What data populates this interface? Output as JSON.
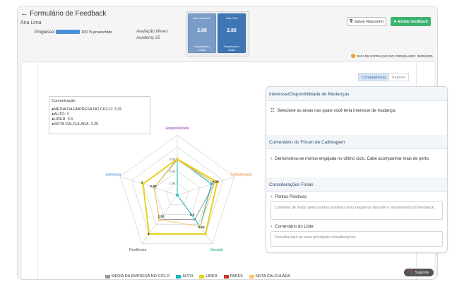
{
  "header": {
    "back_icon": "arrow-left-icon",
    "title": "Formulário de Feedback",
    "user_name": "Ana Lima",
    "progress_label": "Progresso:",
    "progress_value": 100,
    "progress_text": "100 % preenchido",
    "evaluation_line1": "Avaliação Mereo",
    "evaluation_line2": "Academy 25",
    "card1": {
      "title": "Nota Calculada",
      "value": "2.88",
      "sub1": "Proposta para a",
      "sub2": "função"
    },
    "card2": {
      "title": "Nota Final",
      "value": "2.88",
      "sub1": "Proposta para a",
      "sub2": "função"
    },
    "save_label": "Salvar Rascunho",
    "send_label": "Enviar feedback",
    "expiration": "DATA DE EXPIRAÇÃO DO FORMULÁRIO: 30/05/2025"
  },
  "tabs": [
    {
      "label": "Competências",
      "active": true
    },
    {
      "label": "Fatores",
      "active": false
    }
  ],
  "legend_box": {
    "title": "Comunicação",
    "items": [
      "●MÉDIA DA EMPRESA NO CICLO: 3.25",
      "●AUTO: 3",
      "●LIDER: 3.5",
      "●NOTA CALCULADA: 3.25"
    ]
  },
  "chart_data": {
    "type": "radar",
    "axes": [
      "Adaptabilidade",
      "Comunicação",
      "Decisão",
      "Resiliência",
      "Liderança"
    ],
    "rlim": [
      0,
      5
    ],
    "grid_labels": [
      "1.00",
      "2.00",
      "3.00"
    ],
    "series": [
      {
        "name": "MÉDIA DA EMPRESA NO CICLO",
        "color": "#999999",
        "values": [
          3,
          3.25,
          2.5,
          2.52,
          2.03
        ]
      },
      {
        "name": "AUTO",
        "color": "#17b3b3",
        "values": [
          3,
          3,
          3.24,
          0,
          0
        ]
      },
      {
        "name": "LIDER",
        "color": "#e6d21c",
        "values": [
          3,
          3.5,
          4,
          4,
          3
        ]
      },
      {
        "name": "PARES",
        "color": "#c0392b",
        "values": []
      },
      {
        "name": "NOTA CALCULADA",
        "color": "#f7c96b",
        "values": [
          2.9,
          3.25,
          3.24,
          2.52,
          2.03
        ]
      }
    ],
    "data_labels": [
      {
        "text": "3.25",
        "axis": 1,
        "r": 3.35
      },
      {
        "text": "3",
        "axis": 4,
        "r": 3.1
      },
      {
        "text": "2.03",
        "axis": 4,
        "r": 2.1
      },
      {
        "text": "2.5",
        "axis": 2,
        "r": 2.1
      },
      {
        "text": "3.24",
        "axis": 2,
        "r": 3.4
      },
      {
        "text": "2.52",
        "axis": 3,
        "r": 2.3
      },
      {
        "text": "4",
        "axis": 3,
        "r": 4.1
      }
    ],
    "legend_position": "bottom",
    "grid": true
  },
  "panel": {
    "s1_title": "Interesse/Disponibilidade de Mudanças",
    "s1_text": "Selecione as áreas nas quais você teria interesse de mudança:",
    "s2_title": "Comentário do Fórum de Calibragem",
    "s2_text": "Demonstrou-se menos engajada no último ciclo. Cabe acompanhar mais de perto.",
    "s3_title": "Considerações Finais",
    "pos_label": "Pontos Positivos:",
    "pos_placeholder": "Comente de modo geral pontos positivos e/ou negativos durante o recebimento do feedback.",
    "leader_label": "Comentário do Líder:",
    "leader_placeholder": "Resuma aqui as suas principais considerações"
  },
  "support_label": "Suporte"
}
